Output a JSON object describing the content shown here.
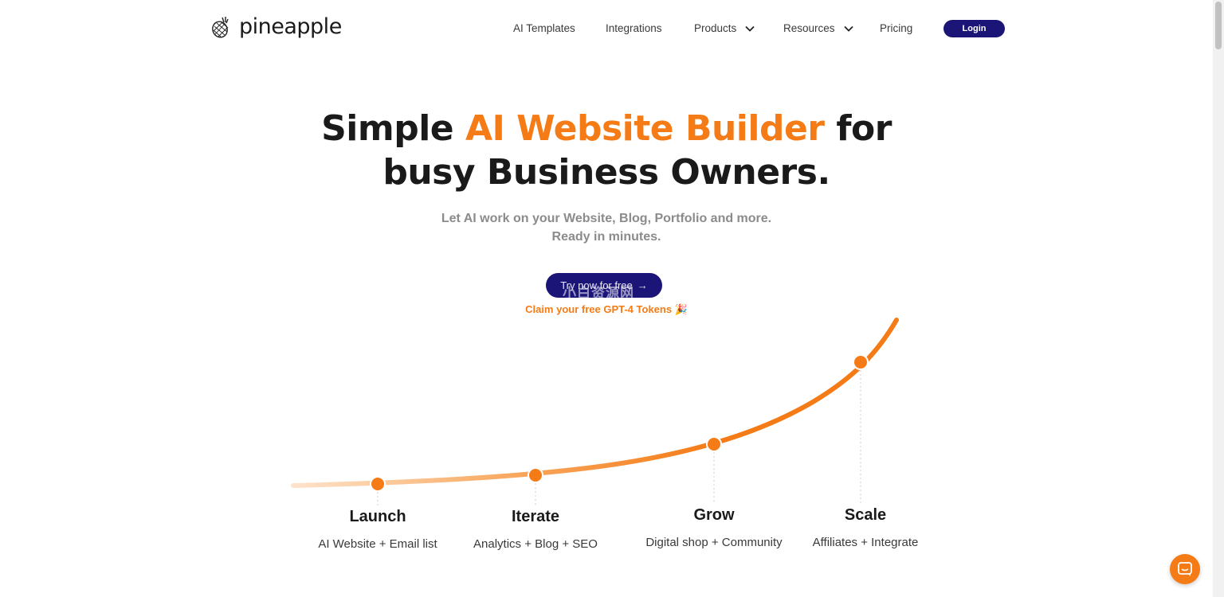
{
  "brand": {
    "name": "pineapple"
  },
  "nav": {
    "items": [
      {
        "label": "AI Templates",
        "has_dropdown": false
      },
      {
        "label": "Integrations",
        "has_dropdown": false
      },
      {
        "label": "Products",
        "has_dropdown": true
      },
      {
        "label": "Resources",
        "has_dropdown": true
      },
      {
        "label": "Pricing",
        "has_dropdown": false
      }
    ],
    "login_label": "Login"
  },
  "hero": {
    "title_line1_start": "Simple ",
    "title_line1_accent": "AI Website Builder",
    "title_line1_end": " for",
    "title_line2": "busy Business Owners.",
    "subtitle_line1": "Let AI work on your Website, Blog, Portfolio and more.",
    "subtitle_line2": "Ready in minutes.",
    "cta_label": "Try now for free",
    "cta_arrow": "→",
    "claim_text": "Claim your free GPT-4 Tokens",
    "claim_emoji": "🎉",
    "watermark": "小白资源网"
  },
  "stages": [
    {
      "title": "Launch",
      "desc": "AI Website + Email list"
    },
    {
      "title": "Iterate",
      "desc": "Analytics + Blog + SEO"
    },
    {
      "title": "Grow",
      "desc": "Digital shop + Community"
    },
    {
      "title": "Scale",
      "desc": "Affiliates + Integrate"
    }
  ],
  "colors": {
    "accent": "#f47b16",
    "primary": "#1c1578",
    "text": "#1a1a1a",
    "muted": "#8b8b8b"
  },
  "icons": {
    "logo": "pineapple-icon",
    "chat": "chat-icon",
    "dropdown": "chevron-down-icon"
  }
}
